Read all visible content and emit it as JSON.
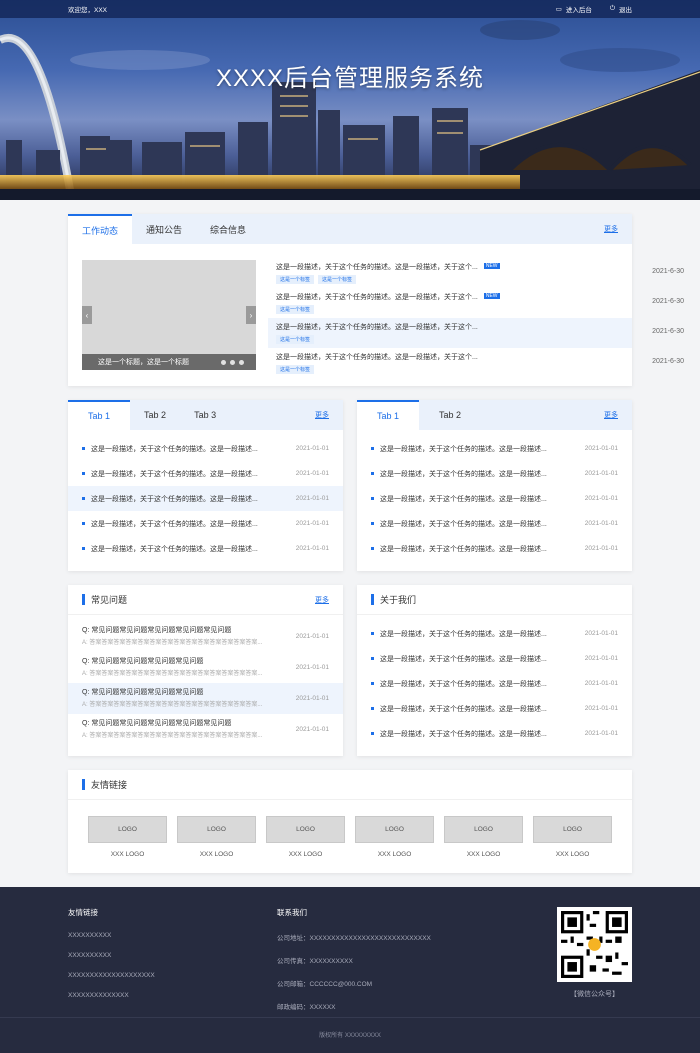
{
  "topbar": {
    "welcome": "欢迎您，XXX",
    "enter_admin": "进入后台",
    "logout": "退出"
  },
  "banner": {
    "title": "XXXX后台管理服务系统"
  },
  "work": {
    "tabs": [
      "工作动态",
      "通知公告",
      "综合信息"
    ],
    "more": "更多",
    "carousel_caption": "这是一个标题，这是一个标题",
    "news": [
      {
        "text": "这是一段描述，关于这个任务的描述。这是一段描述，关于这个...",
        "new": "NEW",
        "tags": [
          "这是一个标签",
          "这是一个标签"
        ],
        "date": "2021-6-30"
      },
      {
        "text": "这是一段描述，关于这个任务的描述。这是一段描述，关于这个...",
        "new": "NEW",
        "tags": [
          "这是一个标签"
        ],
        "date": "2021-6-30"
      },
      {
        "text": "这是一段描述，关于这个任务的描述。这是一段描述，关于这个...",
        "new": "",
        "tags": [
          "这是一个标签"
        ],
        "date": "2021-6-30"
      },
      {
        "text": "这是一段描述，关于这个任务的描述。这是一段描述，关于这个...",
        "new": "",
        "tags": [
          "这是一个标签"
        ],
        "date": "2021-6-30"
      }
    ]
  },
  "left_panel": {
    "tabs": [
      "Tab 1",
      "Tab 2",
      "Tab 3"
    ],
    "more": "更多",
    "items": [
      {
        "text": "这是一段描述，关于这个任务的描述。这是一段描述...",
        "date": "2021-01-01"
      },
      {
        "text": "这是一段描述，关于这个任务的描述。这是一段描述...",
        "date": "2021-01-01"
      },
      {
        "text": "这是一段描述，关于这个任务的描述。这是一段描述...",
        "date": "2021-01-01"
      },
      {
        "text": "这是一段描述，关于这个任务的描述。这是一段描述...",
        "date": "2021-01-01"
      },
      {
        "text": "这是一段描述，关于这个任务的描述。这是一段描述...",
        "date": "2021-01-01"
      }
    ]
  },
  "right_panel": {
    "tabs": [
      "Tab 1",
      "Tab 2"
    ],
    "more": "更多",
    "items": [
      {
        "text": "这是一段描述，关于这个任务的描述。这是一段描述...",
        "date": "2021-01-01"
      },
      {
        "text": "这是一段描述，关于这个任务的描述。这是一段描述...",
        "date": "2021-01-01"
      },
      {
        "text": "这是一段描述，关于这个任务的描述。这是一段描述...",
        "date": "2021-01-01"
      },
      {
        "text": "这是一段描述，关于这个任务的描述。这是一段描述...",
        "date": "2021-01-01"
      },
      {
        "text": "这是一段描述，关于这个任务的描述。这是一段描述...",
        "date": "2021-01-01"
      }
    ]
  },
  "faq": {
    "title": "常见问题",
    "more": "更多",
    "items": [
      {
        "q": "Q:  常见问题常见问题常见问题常见问题常见问题",
        "a": "A:  答案答案答案答案答案答案答案答案答案答案答案答案答案答案...",
        "date": "2021-01-01"
      },
      {
        "q": "Q:  常见问题常见问题常见问题常见问题",
        "a": "A:  答案答案答案答案答案答案答案答案答案答案答案答案答案答案...",
        "date": "2021-01-01"
      },
      {
        "q": "Q:  常见问题常见问题常见问题常见问题",
        "a": "A:  答案答案答案答案答案答案答案答案答案答案答案答案答案答案...",
        "date": "2021-01-01"
      },
      {
        "q": "Q:  常见问题常见问题常见问题常见问题常见问题",
        "a": "A:  答案答案答案答案答案答案答案答案答案答案答案答案答案答案...",
        "date": "2021-01-01"
      }
    ]
  },
  "about": {
    "title": "关于我们",
    "items": [
      {
        "text": "这是一段描述，关于这个任务的描述。这是一段描述...",
        "date": "2021-01-01"
      },
      {
        "text": "这是一段描述，关于这个任务的描述。这是一段描述...",
        "date": "2021-01-01"
      },
      {
        "text": "这是一段描述，关于这个任务的描述。这是一段描述...",
        "date": "2021-01-01"
      },
      {
        "text": "这是一段描述，关于这个任务的描述。这是一段描述...",
        "date": "2021-01-01"
      },
      {
        "text": "这是一段描述，关于这个任务的描述。这是一段描述...",
        "date": "2021-01-01"
      }
    ]
  },
  "friend_links": {
    "title": "友情链接",
    "logos": [
      {
        "box": "LOGO",
        "caption": "XXX LOGO"
      },
      {
        "box": "LOGO",
        "caption": "XXX LOGO"
      },
      {
        "box": "LOGO",
        "caption": "XXX LOGO"
      },
      {
        "box": "LOGO",
        "caption": "XXX LOGO"
      },
      {
        "box": "LOGO",
        "caption": "XXX LOGO"
      },
      {
        "box": "LOGO",
        "caption": "XXX LOGO"
      }
    ]
  },
  "footer": {
    "links_title": "友情链接",
    "links": [
      "XXXXXXXXXX",
      "XXXXXXXXXX",
      "XXXXXXXXXXXXXXXXXXXX",
      "XXXXXXXXXXXXXX"
    ],
    "contact_title": "联系我们",
    "contact": [
      "公司地址：XXXXXXXXXXXXXXXXXXXXXXXXXXXX",
      "公司传真：XXXXXXXXXX",
      "公司邮箱：CCCCCC@000.COM",
      "邮政编码：XXXXXX"
    ],
    "qr_caption": "【微信公众号】",
    "copyright": "版权所有  XXXXXXXXX"
  },
  "colors": {
    "accent": "#1d6fe8",
    "footer_bg": "#262b3f",
    "tab_bg": "#eaf1fb",
    "highlight_row": "#eef4fd"
  }
}
